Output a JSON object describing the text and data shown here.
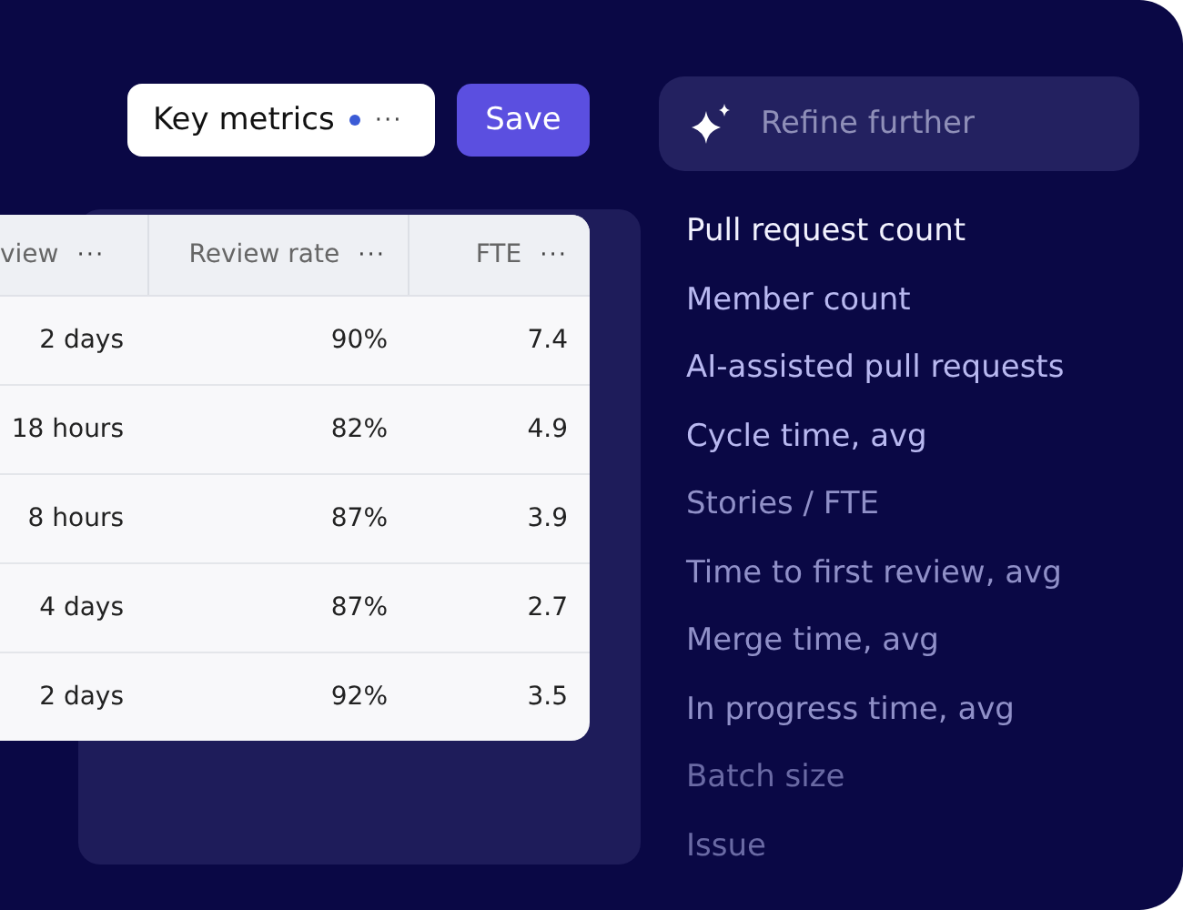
{
  "view_chip": {
    "label": "Key metrics",
    "unsaved": true,
    "more": "···"
  },
  "save_button": {
    "label": "Save"
  },
  "refine": {
    "placeholder": "Refine further"
  },
  "table": {
    "columns": [
      {
        "label": "view",
        "more": "···"
      },
      {
        "label": "Review rate",
        "more": "···"
      },
      {
        "label": "FTE",
        "more": "···"
      }
    ],
    "rows": [
      [
        "2 days",
        "90%",
        "7.4"
      ],
      [
        "18 hours",
        "82%",
        "4.9"
      ],
      [
        "8 hours",
        "87%",
        "3.9"
      ],
      [
        "4 days",
        "87%",
        "2.7"
      ],
      [
        "2 days",
        "92%",
        "3.5"
      ]
    ]
  },
  "metrics": [
    {
      "label": "Pull request count",
      "kind": "bright"
    },
    {
      "label": "Member count",
      "kind": "normal"
    },
    {
      "label": "AI-assisted pull requests",
      "kind": "normal"
    },
    {
      "label": "Cycle time, avg",
      "kind": "normal"
    },
    {
      "label": "Stories / FTE",
      "kind": "dim"
    },
    {
      "label": "Time to first review, avg",
      "kind": "dim"
    },
    {
      "label": "Merge time, avg",
      "kind": "dim"
    },
    {
      "label": "In progress time, avg",
      "kind": "dim"
    },
    {
      "label": "Batch size",
      "kind": "faint"
    },
    {
      "label": "Issue",
      "kind": "faint"
    }
  ]
}
